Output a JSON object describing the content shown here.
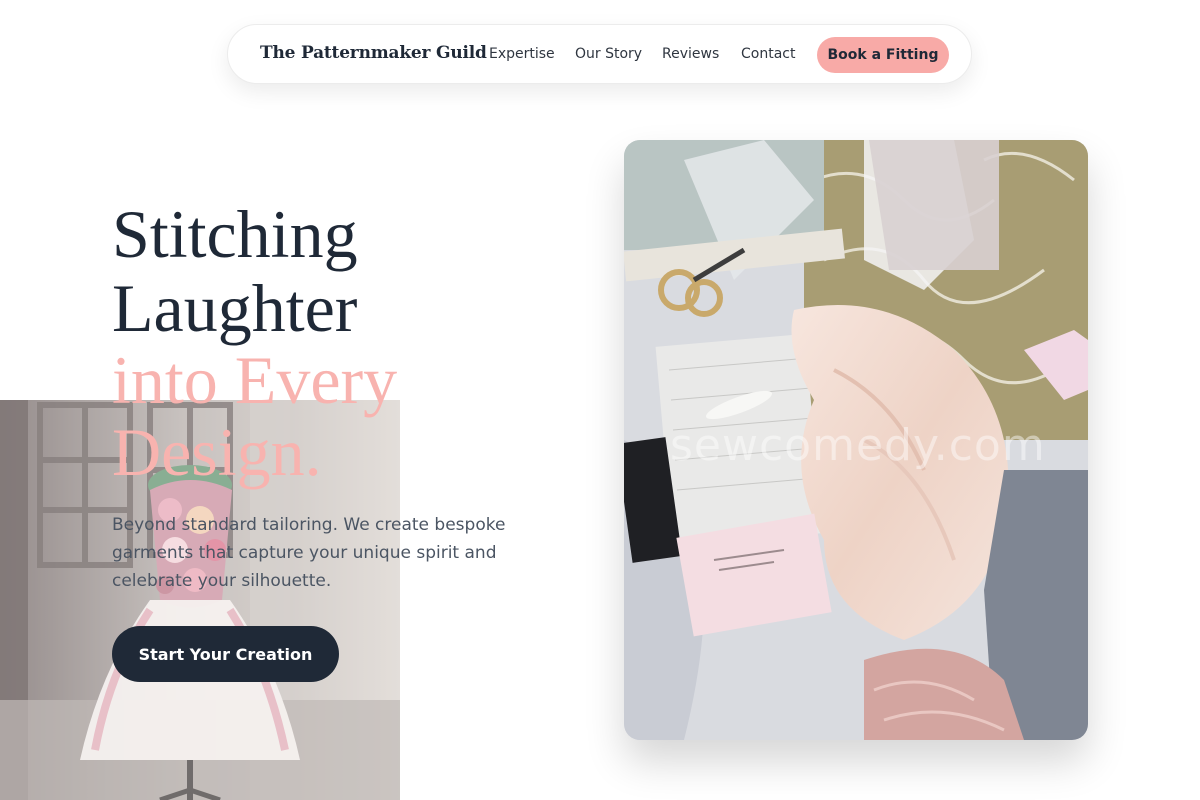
{
  "nav": {
    "brand": "The Patternmaker Guild",
    "links": [
      "Expertise",
      "Our Story",
      "Reviews",
      "Contact"
    ],
    "cta": "Book a Fitting"
  },
  "hero": {
    "title_line1": "Stitching",
    "title_line2": "Laughter",
    "title_line3": "into Every",
    "title_line4": "Design.",
    "subtitle_line1": "Beyond standard tailoring. We create bespoke",
    "subtitle_line2": "garments that capture your unique spirit and",
    "subtitle_line3": "celebrate your silhouette.",
    "button": "Start Your Creation"
  },
  "images": {
    "left": "dress-form-with-flowers-photo",
    "right": "sewing-table-flatlay-photo",
    "watermark": "sewcomedy.com"
  },
  "colors": {
    "navy": "#1f2937",
    "pink": "#f8b3af",
    "cta_pink": "#f8aaa7"
  }
}
